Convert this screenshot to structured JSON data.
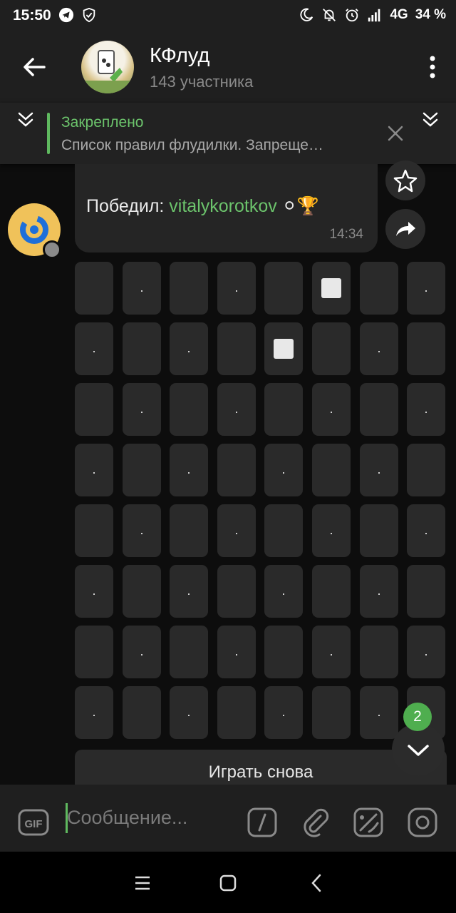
{
  "status_bar": {
    "time": "15:50",
    "network": "4G",
    "battery": "34 %",
    "icons": [
      "telegram-icon",
      "shield-check-icon",
      "moon-icon",
      "bell-off-icon",
      "alarm-icon",
      "signal-icon"
    ]
  },
  "header": {
    "title": "КФлуд",
    "subtitle": "143 участника"
  },
  "pinned": {
    "title": "Закреплено",
    "text": "Список правил флудилки.  Запреще…"
  },
  "message": {
    "text_prefix": "Победил: ",
    "winner": "vitalykorotkov",
    "emoji": "⚪🏆",
    "time": "14:34"
  },
  "game_grid": {
    "rows": [
      [
        "",
        ".",
        "",
        ".",
        "",
        "sq",
        "",
        "."
      ],
      [
        ".",
        "",
        ".",
        "",
        "sq",
        "",
        ".",
        ""
      ],
      [
        "",
        ".",
        "",
        ".",
        "",
        ".",
        "",
        "."
      ],
      [
        ".",
        "",
        ".",
        "",
        ".",
        "",
        ".",
        ""
      ],
      [
        "",
        ".",
        "",
        ".",
        "",
        ".",
        "",
        "."
      ],
      [
        ".",
        "",
        ".",
        "",
        ".",
        "",
        ".",
        ""
      ],
      [
        "",
        ".",
        "",
        ".",
        "",
        ".",
        "",
        "."
      ],
      [
        ".",
        "",
        ".",
        "",
        ".",
        "",
        ".",
        ""
      ]
    ]
  },
  "play_again_label": "Играть снова",
  "unread_count": "2",
  "input": {
    "placeholder": "Сообщение...",
    "gif_label": "GIF"
  },
  "colors": {
    "accent_green": "#5fb95f",
    "bubble": "#252525",
    "cell": "#2a2a2a"
  }
}
